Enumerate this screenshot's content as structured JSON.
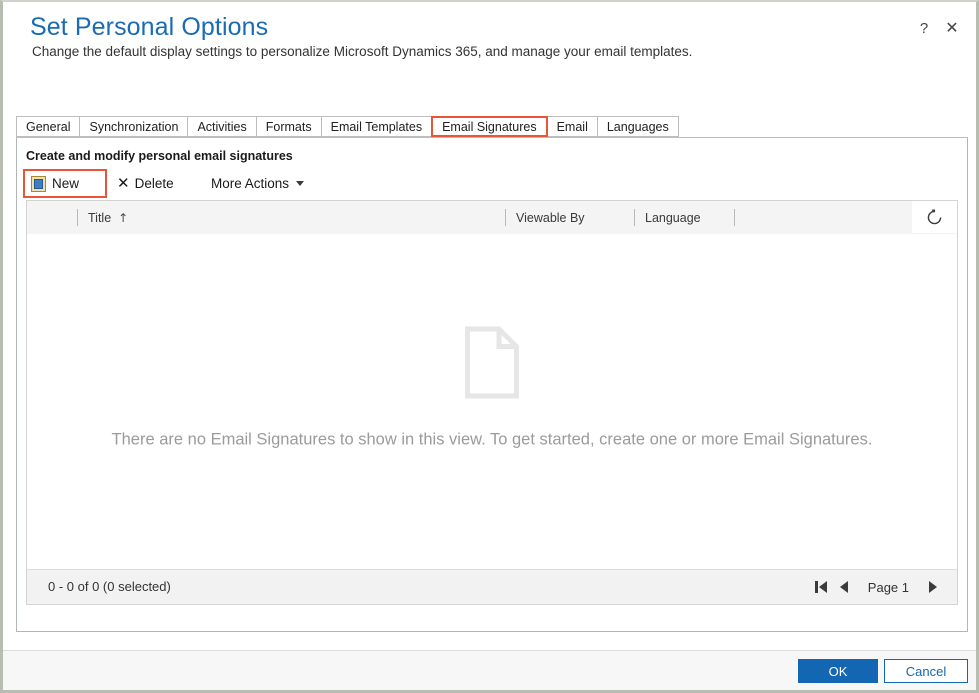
{
  "header": {
    "title": "Set Personal Options",
    "subtitle": "Change the default display settings to personalize Microsoft Dynamics 365, and manage your email templates.",
    "help_label": "?",
    "close_label": "✕"
  },
  "tabs": [
    {
      "label": "General",
      "selected": false
    },
    {
      "label": "Synchronization",
      "selected": false
    },
    {
      "label": "Activities",
      "selected": false
    },
    {
      "label": "Formats",
      "selected": false
    },
    {
      "label": "Email Templates",
      "selected": false
    },
    {
      "label": "Email Signatures",
      "selected": true
    },
    {
      "label": "Email",
      "selected": false
    },
    {
      "label": "Languages",
      "selected": false
    }
  ],
  "panel": {
    "title": "Create and modify personal email signatures"
  },
  "toolbar": {
    "new_label": "New",
    "new_icon": "new-document-icon",
    "delete_label": "Delete",
    "delete_icon": "close-x-icon",
    "more_actions_label": "More Actions",
    "more_actions_icon": "chevron-down-icon"
  },
  "grid": {
    "columns": [
      {
        "label": "Title",
        "sort": "↑"
      },
      {
        "label": "Viewable By",
        "sort": ""
      },
      {
        "label": "Language",
        "sort": ""
      }
    ],
    "refresh_icon": "refresh-icon",
    "rows": [],
    "empty_state": {
      "icon": "empty-document-icon",
      "message": "There are no Email Signatures to show in this view. To get started, create one or more Email Signatures."
    },
    "footer": {
      "record_count": "0 - 0 of 0 (0 selected)",
      "page_label": "Page 1",
      "first_page_icon": "first-page-icon",
      "prev_page_icon": "previous-page-icon",
      "next_page_icon": "next-page-icon"
    }
  },
  "footer": {
    "ok_label": "OK",
    "cancel_label": "Cancel"
  },
  "colors": {
    "title_blue": "#1a6bb5",
    "accent_button": "#1366b2",
    "highlight_outline": "#e8563a",
    "empty_text": "#9b9b9b"
  }
}
